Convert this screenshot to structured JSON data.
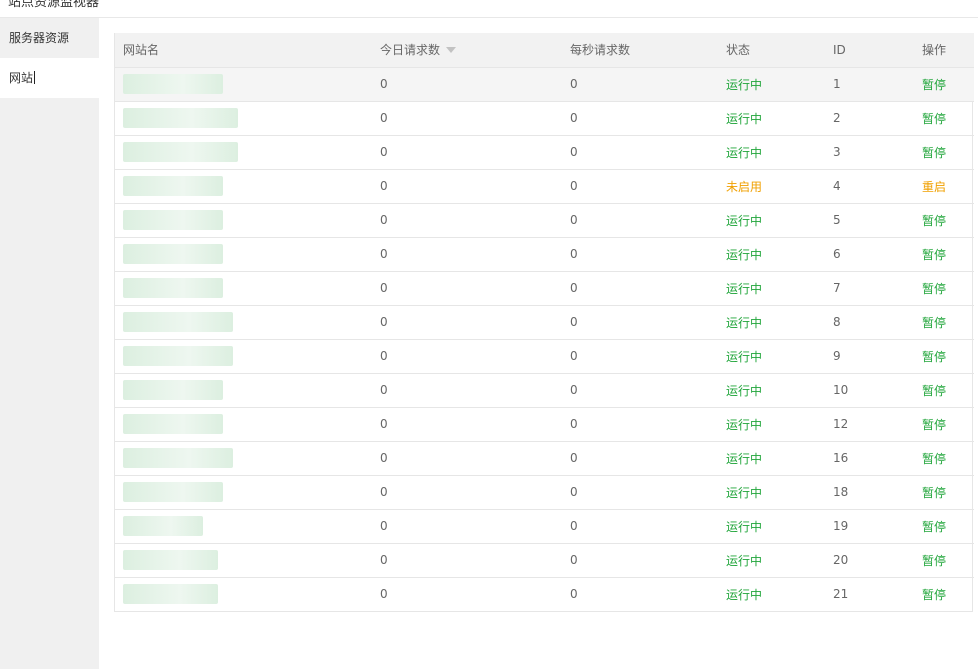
{
  "header": {
    "title": "站点资源监视器"
  },
  "sidebar": {
    "items": [
      {
        "label": "服务器资源",
        "active": false
      },
      {
        "label": "网站",
        "active": true
      }
    ]
  },
  "table": {
    "columns": {
      "name": "网站名",
      "today_requests": "今日请求数",
      "per_second": "每秒请求数",
      "status": "状态",
      "id": "ID",
      "action": "操作"
    },
    "sort_icon": "sort-down-icon",
    "rows": [
      {
        "today": "0",
        "per_second": "0",
        "status": "运行中",
        "id": "1",
        "action": "暂停"
      },
      {
        "today": "0",
        "per_second": "0",
        "status": "运行中",
        "id": "2",
        "action": "暂停"
      },
      {
        "today": "0",
        "per_second": "0",
        "status": "运行中",
        "id": "3",
        "action": "暂停"
      },
      {
        "today": "0",
        "per_second": "0",
        "status": "未启用",
        "id": "4",
        "action": "重启"
      },
      {
        "today": "0",
        "per_second": "0",
        "status": "运行中",
        "id": "5",
        "action": "暂停"
      },
      {
        "today": "0",
        "per_second": "0",
        "status": "运行中",
        "id": "6",
        "action": "暂停"
      },
      {
        "today": "0",
        "per_second": "0",
        "status": "运行中",
        "id": "7",
        "action": "暂停"
      },
      {
        "today": "0",
        "per_second": "0",
        "status": "运行中",
        "id": "8",
        "action": "暂停"
      },
      {
        "today": "0",
        "per_second": "0",
        "status": "运行中",
        "id": "9",
        "action": "暂停"
      },
      {
        "today": "0",
        "per_second": "0",
        "status": "运行中",
        "id": "10",
        "action": "暂停"
      },
      {
        "today": "0",
        "per_second": "0",
        "status": "运行中",
        "id": "12",
        "action": "暂停"
      },
      {
        "today": "0",
        "per_second": "0",
        "status": "运行中",
        "id": "16",
        "action": "暂停"
      },
      {
        "today": "0",
        "per_second": "0",
        "status": "运行中",
        "id": "18",
        "action": "暂停"
      },
      {
        "today": "0",
        "per_second": "0",
        "status": "运行中",
        "id": "19",
        "action": "暂停"
      },
      {
        "today": "0",
        "per_second": "0",
        "status": "运行中",
        "id": "20",
        "action": "暂停"
      },
      {
        "today": "0",
        "per_second": "0",
        "status": "运行中",
        "id": "21",
        "action": "暂停"
      }
    ]
  },
  "colors": {
    "running": "#20a53a",
    "stopped": "#f0a000",
    "blur": "#dcefe0"
  }
}
